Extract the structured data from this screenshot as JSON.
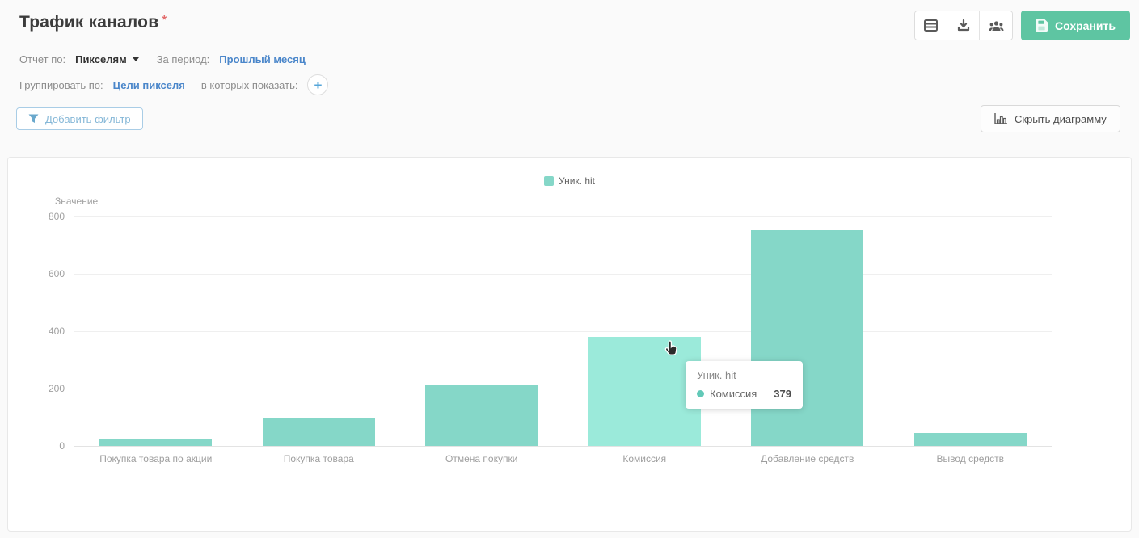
{
  "page": {
    "title": "Трафик каналов",
    "required_mark": "*"
  },
  "toolbar": {
    "save_label": "Сохранить"
  },
  "controls": {
    "report_by_label": "Отчет по:",
    "report_by_value": "Пикселям",
    "period_label": "За период:",
    "period_value": "Прошлый месяц",
    "group_by_label": "Группировать по:",
    "group_by_value": "Цели пикселя",
    "show_in_label": "в которых показать:",
    "plus_glyph": "+"
  },
  "filters": {
    "add_filter_label": "Добавить фильтр",
    "hide_chart_label": "Скрыть диаграмму"
  },
  "chart_data": {
    "type": "bar",
    "title": "",
    "series_name": "Уник. hit",
    "ylabel": "Значение",
    "categories": [
      "Покупка товара по акции",
      "Покупка товара",
      "Отмена покупки",
      "Комиссия",
      "Добавление средств",
      "Вывод средств"
    ],
    "values": [
      23,
      97,
      213,
      379,
      751,
      44
    ],
    "ylim": [
      0,
      800
    ],
    "yticks": [
      0,
      200,
      400,
      600,
      800
    ],
    "grid": true,
    "legend_position": "top-center",
    "hover_index": 3,
    "colors": {
      "bar": "#85d7c8",
      "bar_hover": "#9beada"
    }
  },
  "tooltip": {
    "series": "Уник. hit",
    "category": "Комиссия",
    "value": "379"
  }
}
